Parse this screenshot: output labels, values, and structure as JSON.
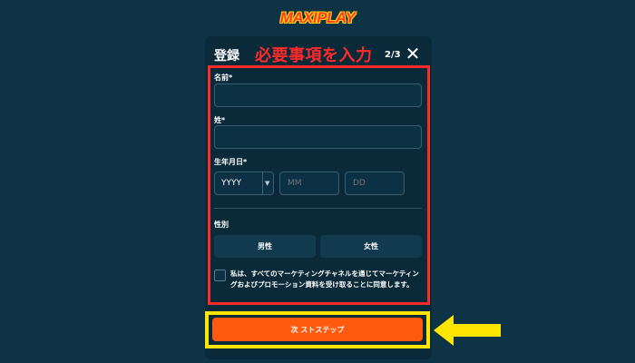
{
  "brand": {
    "logo_text": "MAXIPLAY"
  },
  "modal": {
    "title": "登録",
    "step": "2/3",
    "close_glyph": "✕"
  },
  "annotation": {
    "title": "必要事項を入力",
    "frame_color": "#ff2a2a",
    "highlight_color": "#ffe600"
  },
  "form": {
    "first_name_label": "名前*",
    "first_name_value": "",
    "last_name_label": "姓*",
    "last_name_value": "",
    "dob_label": "生年月日*",
    "year_value": "YYYY",
    "month_placeholder": "MM",
    "day_placeholder": "DD",
    "gender_label": "性別",
    "gender_male": "男性",
    "gender_female": "女性",
    "consent_text": "私は、すべてのマーケティングチャネルを通じてマーケティングおよびプロモーション資料を受け取ることに同意します。",
    "consent_checked": false
  },
  "actions": {
    "next_label": "次 ストステップ",
    "next_color": "#ff5a0e"
  },
  "colors": {
    "background": "#0e3346",
    "modal": "#0a2a3a"
  }
}
